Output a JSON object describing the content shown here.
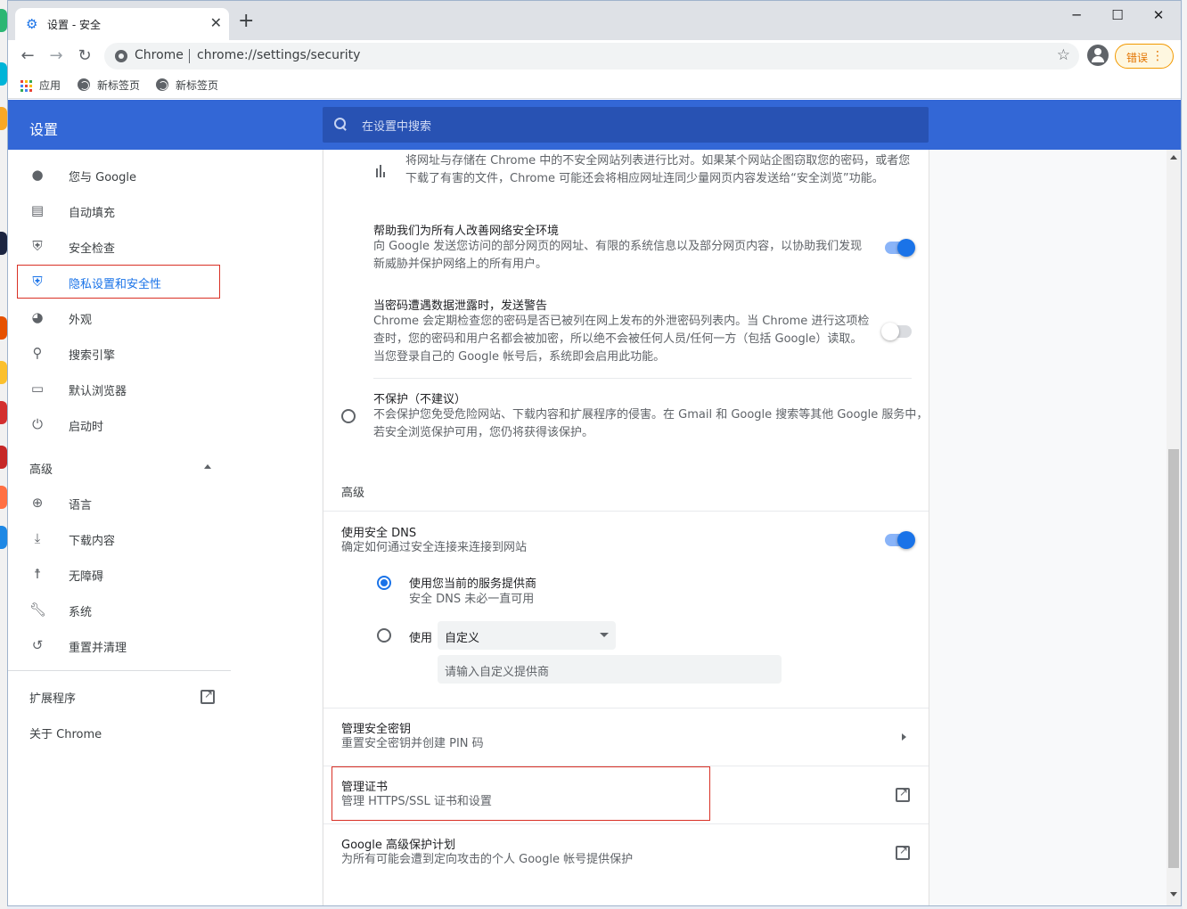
{
  "window": {
    "tab_title": "设置 - 安全",
    "controls": {
      "minimize": "─",
      "maximize": "☐",
      "close": "✕"
    }
  },
  "toolbar": {
    "site_label": "Chrome",
    "url": "chrome://settings/security",
    "error_button": "错误"
  },
  "bookmarks": [
    {
      "label": "应用",
      "icon": "apps-grid-icon"
    },
    {
      "label": "新标签页",
      "icon": "globe-icon"
    },
    {
      "label": "新标签页",
      "icon": "globe-icon"
    }
  ],
  "header": {
    "title": "设置",
    "search_placeholder": "在设置中搜索"
  },
  "sidebar": {
    "items": [
      {
        "label": "您与 Google",
        "icon": "person-icon"
      },
      {
        "label": "自动填充",
        "icon": "clipboard-icon"
      },
      {
        "label": "安全检查",
        "icon": "shield-check-icon"
      },
      {
        "label": "隐私设置和安全性",
        "icon": "shield-icon"
      },
      {
        "label": "外观",
        "icon": "palette-icon"
      },
      {
        "label": "搜索引擎",
        "icon": "search-icon"
      },
      {
        "label": "默认浏览器",
        "icon": "browser-icon"
      },
      {
        "label": "启动时",
        "icon": "power-icon"
      }
    ],
    "advanced_label": "高级",
    "advanced_items": [
      {
        "label": "语言",
        "icon": "globe-icon"
      },
      {
        "label": "下载内容",
        "icon": "download-icon"
      },
      {
        "label": "无障碍",
        "icon": "accessibility-icon"
      },
      {
        "label": "系统",
        "icon": "wrench-icon"
      },
      {
        "label": "重置并清理",
        "icon": "history-icon"
      }
    ],
    "extensions_label": "扩展程序",
    "about_label": "关于 Chrome"
  },
  "main": {
    "top_text_line1": "将网址与存储在 Chrome 中的不安全网站列表进行比对。如果某个网站企图窃取您的密码，或者您",
    "top_text_line2": "下载了有害的文件，Chrome 可能还会将相应网址连同少量网页内容发送给“安全浏览”功能。",
    "help_title": "帮助我们为所有人改善网络安全环境",
    "help_sub_line1": "向 Google 发送您访问的部分网页的网址、有限的系统信息以及部分网页内容，以协助我们发现",
    "help_sub_line2": "新威胁并保护网络上的所有用户。",
    "help_enabled": true,
    "pw_title": "当密码遭遇数据泄露时，发送警告",
    "pw_sub_line1": "Chrome 会定期检查您的密码是否已被列在网上发布的外泄密码列表内。当 Chrome 进行这项检",
    "pw_sub_line2": "查时，您的密码和用户名都会被加密，所以绝不会被任何人员/任何一方（包括 Google）读取。",
    "pw_sub_line3": "当您登录自己的 Google 帐号后，系统即会启用此功能。",
    "pw_enabled": false,
    "noprotect_title": "不保护（不建议）",
    "noprotect_sub_line1": "不会保护您免受危险网站、下载内容和扩展程序的侵害。在 Gmail 和 Google 搜索等其他 Google 服务中，",
    "noprotect_sub_line2": "若安全浏览保护可用，您仍将获得该保护。",
    "advanced_heading": "高级",
    "dns_title": "使用安全 DNS",
    "dns_sub": "确定如何通过安全连接来连接到网站",
    "dns_enabled": true,
    "dns_option1_title": "使用您当前的服务提供商",
    "dns_option1_sub": "安全 DNS 未必一直可用",
    "dns_option2_label": "使用",
    "dns_select_value": "自定义",
    "dns_input_placeholder": "请输入自定义提供商",
    "keys_title": "管理安全密钥",
    "keys_sub": "重置安全密钥并创建 PIN 码",
    "cert_title": "管理证书",
    "cert_sub": "管理 HTTPS/SSL 证书和设置",
    "gapp_title": "Google 高级保护计划",
    "gapp_sub": "为所有可能会遭到定向攻击的个人 Google 帐号提供保护"
  },
  "colors": {
    "header": "#3367d6",
    "accent": "#1a73e8",
    "highlight": "#d93025"
  }
}
